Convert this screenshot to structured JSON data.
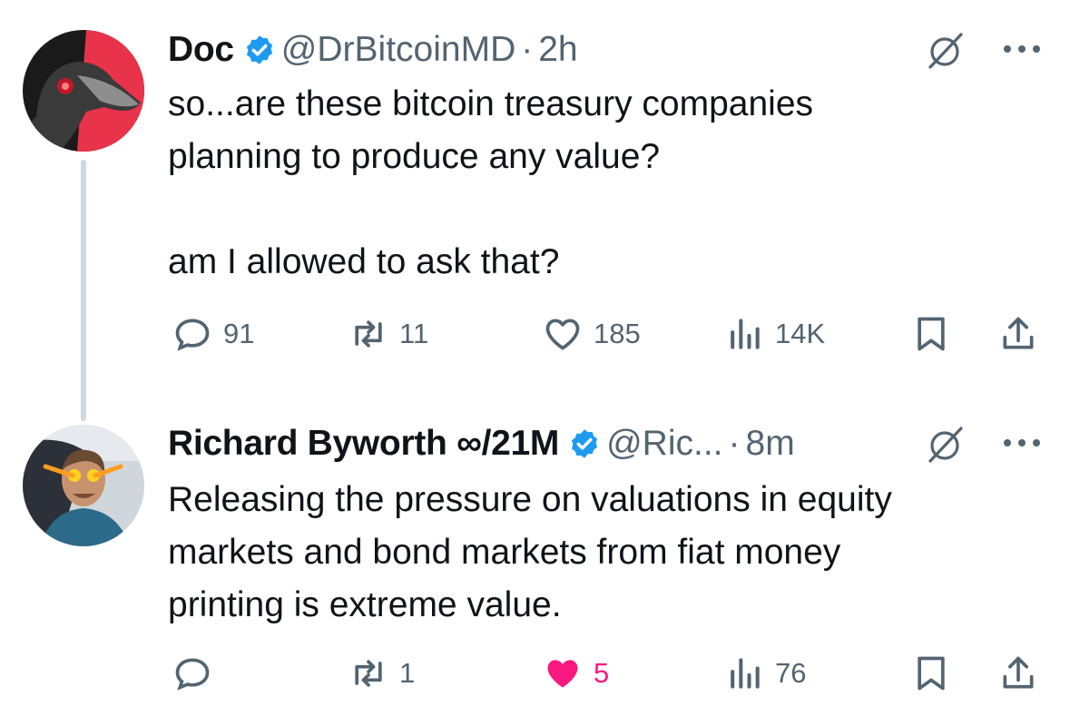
{
  "tweets": [
    {
      "name": "Doc",
      "handle": "@DrBitcoinMD",
      "separator": "·",
      "time": "2h",
      "text": "so...are these bitcoin treasury companies\nplanning to produce any value?\n\nam I allowed to ask that?",
      "replies": "91",
      "reposts": "11",
      "likes": "185",
      "views": "14K",
      "liked": false
    },
    {
      "name": "Richard Byworth ∞/21M",
      "handle": "@Ric...",
      "separator": "·",
      "time": "8m",
      "text": "Releasing the pressure on valuations in equity\nmarkets and bond markets from fiat money\nprinting is extreme value.",
      "replies": "",
      "reposts": "1",
      "likes": "5",
      "views": "76",
      "liked": true
    }
  ],
  "icons": {
    "reply": "reply-icon",
    "repost": "repost-icon",
    "like": "heart-icon",
    "views": "views-icon",
    "bookmark": "bookmark-icon",
    "share": "share-icon",
    "grok": "grok-icon",
    "more": "more-icon",
    "verified": "verified-badge-icon"
  },
  "colors": {
    "text": "#0f1419",
    "secondary": "#536471",
    "verified": "#1d9bf0",
    "like_active": "#f91880",
    "thread_line": "#cfd9de"
  }
}
